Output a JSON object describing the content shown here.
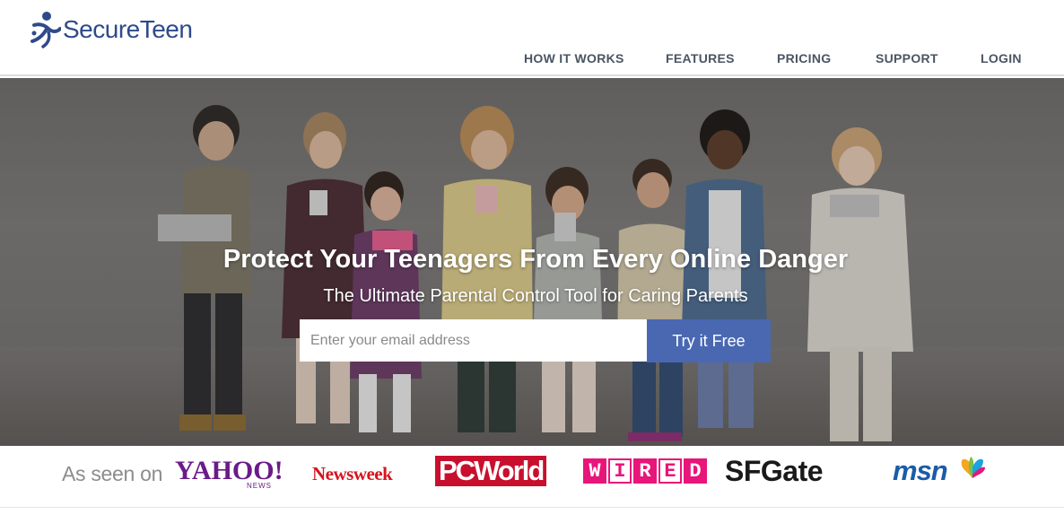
{
  "brand": {
    "name": "SecureTeen"
  },
  "nav": {
    "items": [
      {
        "label": "HOW IT WORKS"
      },
      {
        "label": "FEATURES"
      },
      {
        "label": "PRICING"
      },
      {
        "label": "SUPPORT"
      },
      {
        "label": "LOGIN"
      }
    ]
  },
  "hero": {
    "title": "Protect Your Teenagers From Every Online Danger",
    "subtitle": "The Ultimate Parental Control Tool for Caring Parents",
    "email_placeholder": "Enter your email address",
    "cta_label": "Try it Free"
  },
  "press": {
    "label": "As seen on",
    "logos": {
      "yahoo": "YAHOO!",
      "yahoo_sub": "NEWS",
      "newsweek": "Newsweek",
      "pcworld": "PCWorld",
      "wired": [
        "W",
        "I",
        "R",
        "E",
        "D"
      ],
      "sfgate": "SFGate",
      "msn": "msn"
    }
  },
  "colors": {
    "brand_blue": "#2f4a8a",
    "cta_blue": "#4a68b2",
    "nav_text": "#4a5563",
    "yahoo": "#6a1b88",
    "newsweek": "#d7141e",
    "pcworld": "#c8102e",
    "wired": "#e8157a",
    "msn": "#1a5ca8"
  }
}
